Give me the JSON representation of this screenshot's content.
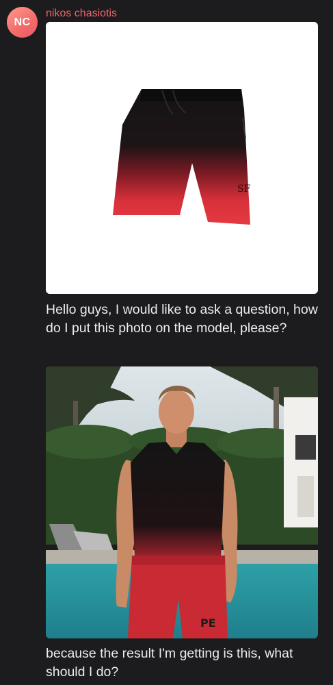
{
  "message": {
    "avatar_initials": "NC",
    "sender_name": "nikos chasiotis",
    "text_1": "Hello guys, I would like to ask a question, how do I put this photo on the model, please?",
    "text_2": "because the result I'm getting is this, what should I do?"
  },
  "colors": {
    "background": "#1c1c1e",
    "sender_name": "#f0646a",
    "avatar": "#f26b6b",
    "text": "#ececec"
  }
}
